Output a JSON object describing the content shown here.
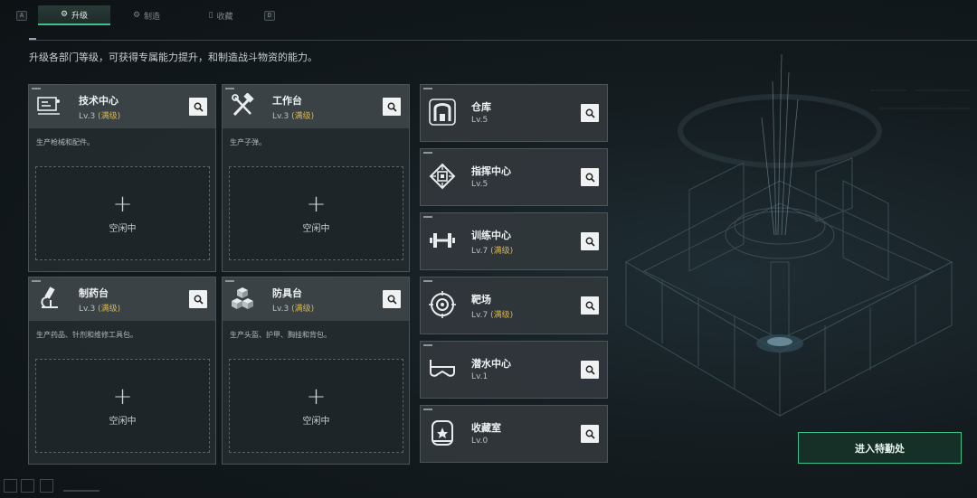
{
  "tabs": {
    "left_key": "A",
    "right_key": "D",
    "items": [
      {
        "label": "升级",
        "icon": "upgrade-gear-icon",
        "active": true
      },
      {
        "label": "制造",
        "icon": "craft-gear-icon",
        "active": false
      },
      {
        "label": "收藏",
        "icon": "collection-icon",
        "active": false
      }
    ]
  },
  "subtitle": "升级各部门等级，可获得专属能力提升，和制造战斗物资的能力。",
  "workshops": [
    {
      "name": "技术中心",
      "level": "Lv.3",
      "max": "(满级)",
      "desc": "生产枪械和配件。",
      "icon": "tech-center-icon",
      "slot_plus": "+",
      "slot_status": "空闲中"
    },
    {
      "name": "工作台",
      "level": "Lv.3",
      "max": "(满级)",
      "desc": "生产子弹。",
      "icon": "workbench-tools-icon",
      "slot_plus": "+",
      "slot_status": "空闲中"
    },
    {
      "name": "制药台",
      "level": "Lv.3",
      "max": "(满级)",
      "desc": "生产药品、针剂和维修工具包。",
      "icon": "microscope-icon",
      "slot_plus": "+",
      "slot_status": "空闲中"
    },
    {
      "name": "防具台",
      "level": "Lv.3",
      "max": "(满级)",
      "desc": "生产头盔、护甲、胸挂和背包。",
      "icon": "armor-cubes-icon",
      "slot_plus": "+",
      "slot_status": "空闲中"
    }
  ],
  "facilities": [
    {
      "name": "仓库",
      "level": "Lv.5",
      "max": "",
      "icon": "warehouse-icon"
    },
    {
      "name": "指挥中心",
      "level": "Lv.5",
      "max": "",
      "icon": "command-chip-icon"
    },
    {
      "name": "训练中心",
      "level": "Lv.7",
      "max": "(满级)",
      "icon": "dumbbell-icon"
    },
    {
      "name": "靶场",
      "level": "Lv.7",
      "max": "(满级)",
      "icon": "target-icon"
    },
    {
      "name": "潜水中心",
      "level": "Lv.1",
      "max": "",
      "icon": "diving-mask-icon"
    },
    {
      "name": "收藏室",
      "level": "Lv.0",
      "max": "",
      "icon": "collection-room-icon"
    }
  ],
  "enter_button": "进入特勤处",
  "colors": {
    "accent": "#3fbf8a",
    "max_level": "#d9b54a",
    "card": "#3a4246"
  }
}
